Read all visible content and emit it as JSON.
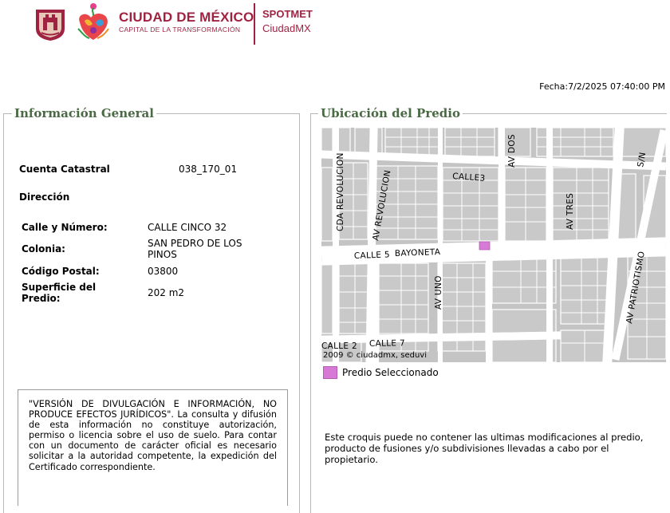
{
  "header": {
    "brand_title": "CIUDAD DE MÉXICO",
    "brand_subtitle": "CAPITAL DE LA TRANSFORMACIÓN",
    "app_title": "SPOTMET",
    "app_subtitle": "CiudadMX",
    "brand_color": "#9f2241"
  },
  "fecha": "Fecha:7/2/2025 07:40:00 PM",
  "general": {
    "legend": "Información General",
    "cuenta_label": "Cuenta Catastral",
    "cuenta_value": "038_170_01",
    "direccion_label": "Dirección",
    "calle_label": "Calle y Número:",
    "calle_value": "CALLE CINCO 32",
    "colonia_label": "Colonia:",
    "colonia_value": "SAN PEDRO DE LOS PINOS",
    "cp_label": "Código Postal:",
    "cp_value": "03800",
    "superficie_label": "Superficie del Predio:",
    "superficie_value": "202 m2"
  },
  "disclaimer": "\"VERSIÓN DE DIVULGACIÓN E INFORMACIÓN, NO PRODUCE EFECTOS JURÍDICOS\". La consulta y difusión de esta información no constituye autorización, permiso o licencia sobre el uso de suelo. Para contar con un documento de carácter oficial es necesario solicitar a la autoridad competente, la expedición del Certificado correspondiente.",
  "ubicacion": {
    "legend": "Ubicación del Predio",
    "streets": {
      "cda_revolucion": "CDA REVOLUCION",
      "av_revolucion": "AV REVOLUCION",
      "calle3": "CALLE3",
      "av_dos": "AV DOS",
      "av_tres": "AV TRES",
      "sn": "S/N",
      "calle5": "CALLE 5",
      "bayoneta": "BAYONETA",
      "av_uno": "AV UNO",
      "patriotismo": "AV PATRIOTISMO",
      "calle2": "CALLE 2",
      "calle7": "CALLE 7"
    },
    "credit": "2009 © ciudadmx, seduvi",
    "legend_label": "Predio Seleccionado",
    "selected_color": "#d77ad6",
    "note": "Este croquis puede no contener las ultimas modificaciones al predio, producto de fusiones y/o subdivisiones llevadas a cabo por el propietario."
  }
}
